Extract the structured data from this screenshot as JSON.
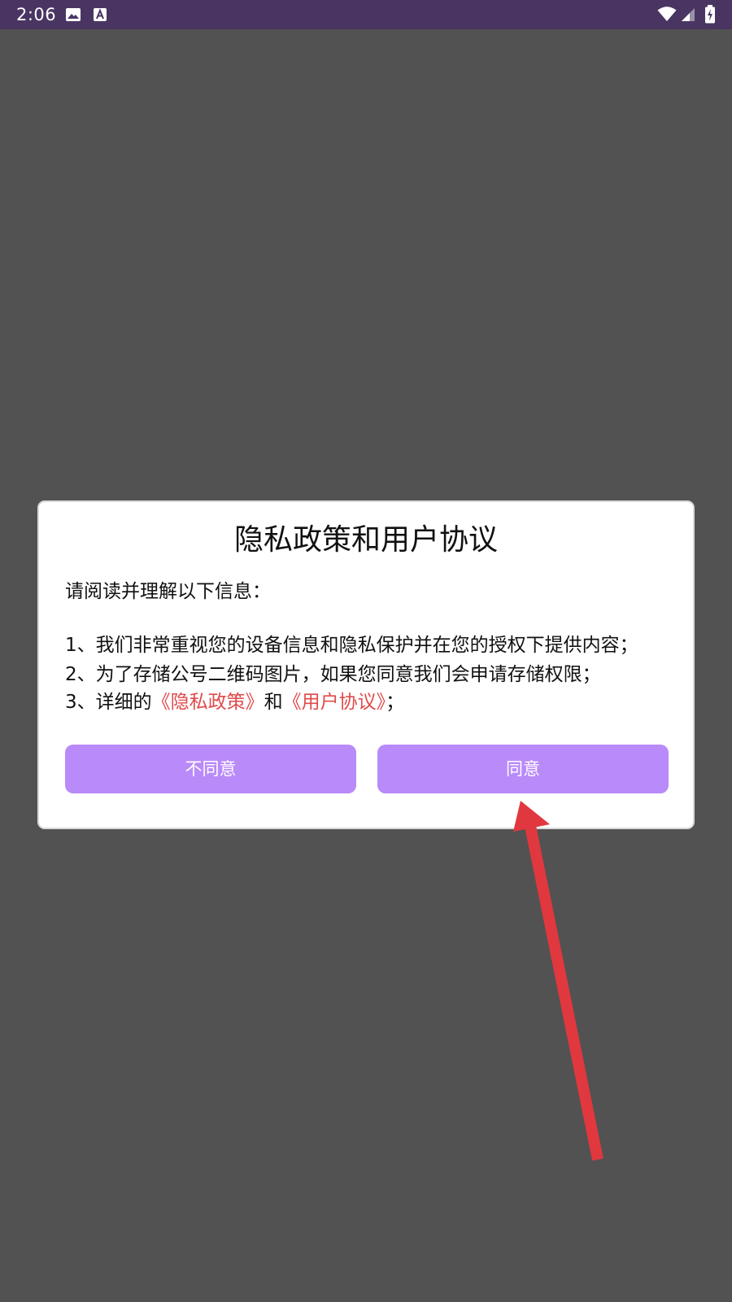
{
  "status_bar": {
    "time": "2:06",
    "icons": [
      "image-icon",
      "keyboard-a-icon",
      "wifi-icon",
      "signal-icon",
      "battery-charging-icon"
    ]
  },
  "dialog": {
    "title": "隐私政策和用户协议",
    "intro": "请阅读并理解以下信息：",
    "clause1": "1、我们非常重视您的设备信息和隐私保护并在您的授权下提供内容；",
    "clause2": "2、为了存储公号二维码图片，如果您同意我们会申请存储权限；",
    "clause3_prefix": "3、详细的",
    "privacy_link": "《隐私政策》",
    "clause3_and": "和",
    "agreement_link": "《用户协议》",
    "clause3_suffix": "；",
    "disagree_label": "不同意",
    "agree_label": "同意"
  },
  "colors": {
    "status_bar": "#4a3562",
    "backdrop": "#525252",
    "button": "#b98af9",
    "link": "#e04a4a",
    "annotation_arrow": "#e0383e"
  }
}
